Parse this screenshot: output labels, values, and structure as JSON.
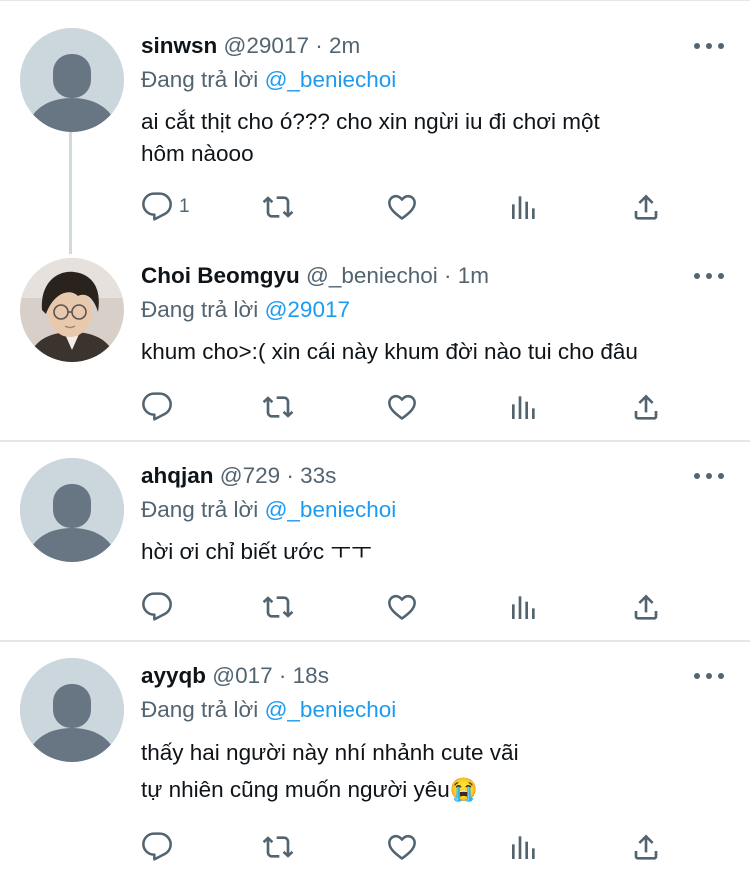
{
  "tweets": [
    {
      "name": "sinwsn",
      "meta": "@29017 · 2m",
      "reply_prefix": "Đang trả lời",
      "reply_to": "@_beniechoi",
      "lines": [
        "ai cắt thịt cho ó??? cho xin ngừi iu đi chơi một",
        "hôm nàooo"
      ],
      "reply_count": "1",
      "avatar": "default-avatar"
    },
    {
      "name": "Choi Beomgyu",
      "meta": "@_beniechoi · 1m",
      "reply_prefix": "Đang trả lời",
      "reply_to": "@29017",
      "lines": [
        "khum cho>:( xin cái này khum đời nào tui cho đâu"
      ],
      "reply_count": "",
      "avatar": "profile-photo"
    },
    {
      "name": "ahqjan",
      "meta": "@729 · 33s",
      "reply_prefix": "Đang trả lời",
      "reply_to": "@_beniechoi",
      "lines": [
        "hời ơi chỉ biết ước ㅜㅜ"
      ],
      "reply_count": "",
      "avatar": "default-avatar"
    },
    {
      "name": "ayyqb",
      "meta": "@017 · 18s",
      "reply_prefix": "Đang trả lời",
      "reply_to": "@_beniechoi",
      "lines": [
        "thấy hai người này nhí nhảnh cute vãi",
        "tự nhiên cũng muốn người yêu😭"
      ],
      "reply_count": "",
      "avatar": "default-avatar"
    }
  ],
  "icons": {
    "reply": "reply-icon",
    "retweet": "retweet-icon",
    "like": "like-icon",
    "views": "views-icon",
    "share": "share-icon",
    "more": "more-icon"
  },
  "colors": {
    "text": "#0f1419",
    "secondary": "#536471",
    "link": "#1d9bf0",
    "avatar_bg": "#ccd6dd",
    "avatar_fg": "#687684",
    "divider": "#e4e6e8"
  }
}
